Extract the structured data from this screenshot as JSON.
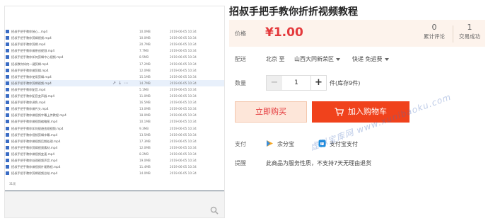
{
  "gallery": {
    "files": [
      {
        "name": "招叔手把手教你装心...mp4",
        "size": "10.0MB",
        "date": "2019-06-05 10:34"
      },
      {
        "name": "招叔手把手教你剪辑视频.mp4",
        "size": "10.0MB",
        "date": "2019-06-05 10:34"
      },
      {
        "name": "招叔手把手教你剪辑.mp4",
        "size": "20.7MB",
        "date": "2019-06-05 10:34"
      },
      {
        "name": "招叔手把手教你做原创视频.mp4",
        "size": "7.7MB",
        "date": "2019-06-05 10:34"
      },
      {
        "name": "招叔手把手教你如何剪辑中心视频.mp4",
        "size": "8.5MB",
        "date": "2019-06-05 10:34"
      },
      {
        "name": "招叔教你如何一键剪辑.mp4",
        "size": "17.2MB",
        "date": "2019-06-05 10:34"
      },
      {
        "name": "招叔手把手教你做剪辑.mp4",
        "size": "12.0MB",
        "date": "2019-06-05 10:34"
      },
      {
        "name": "招叔手把手教你使用剪辑.mp4",
        "size": "15.1MB",
        "date": "2019-06-05 10:34"
      },
      {
        "name": "招叔手把手教你剪辑视频.mp4",
        "size": "14.7MB",
        "date": "2019-06-05 10:34",
        "highlight": true
      },
      {
        "name": "招叔手把手教你配音.mp4",
        "size": "5.1MB",
        "date": "2019-06-05 10:34"
      },
      {
        "name": "招叔手把手教你配音变声器.mp4",
        "size": "11.0MB",
        "date": "2019-06-05 10:34"
      },
      {
        "name": "招叔手把手教你调色.mp4",
        "size": "16.5MB",
        "date": "2019-06-05 10:34"
      },
      {
        "name": "招叔手把手教你做片头.mp4",
        "size": "13.0MB",
        "date": "2019-06-05 10:34"
      },
      {
        "name": "招叔手把手教你做视频字幕上传教程.mp4",
        "size": "18.0MB",
        "date": "2019-06-05 10:34"
      },
      {
        "name": "招叔手把手教你做视频缩略图.mp4",
        "size": "10.1MB",
        "date": "2019-06-05 10:34"
      },
      {
        "name": "招叔手把手教你如何规避违规视频.mp4",
        "size": "9.3MB",
        "date": "2019-06-05 10:34"
      },
      {
        "name": "招叔手把手教你视频剪辑字幕.mp4",
        "size": "13.5MB",
        "date": "2019-06-05 10:34"
      },
      {
        "name": "招叔手把手教你做视频后期处理.mp4",
        "size": "17.3MB",
        "date": "2019-06-05 10:34"
      },
      {
        "name": "招叔手把手教你剪辑视频素材.mp4",
        "size": "12.0MB",
        "date": "2019-06-05 10:34"
      },
      {
        "name": "招叔手把手教你做视频变速.mp4",
        "size": "8.2MB",
        "date": "2019-06-05 10:34"
      },
      {
        "name": "招叔手把手教你处理视频声音.mp4",
        "size": "19.0MB",
        "date": "2019-06-05 10:34"
      },
      {
        "name": "招叔手把手教你做视频片尾教程.mp4",
        "size": "11.4MB",
        "date": "2019-06-05 10:34"
      },
      {
        "name": "招叔手把手教你剪辑视频总结.mp4",
        "size": "14.0MB",
        "date": "2019-06-05 10:34"
      }
    ],
    "count_text": "31项"
  },
  "product": {
    "title": "招叔手把手教你折折视频教程",
    "price_label": "价格",
    "price": "¥1.00",
    "reviews_count": "0",
    "reviews_label": "累计评论",
    "sales_count": "1",
    "sales_label": "交易成功",
    "delivery_label": "配送",
    "delivery_from": "北京 至",
    "delivery_to": "山西大同新荣区",
    "shipping": "快递 免运费",
    "qty_label": "数量",
    "qty_minus": "−",
    "qty_value": "1",
    "qty_plus": "+",
    "stock": "件(库存9件)",
    "buy_now": "立即购买",
    "add_cart": "加入购物车",
    "pay_label": "支付",
    "pay1": "余分宝",
    "pay2": "支付宝支付",
    "notice_label": "提醒",
    "notice": "此商品为服务性质，不支持7天无理由退货",
    "watermark": "虚拟宝库网 www.xunibaoku.com"
  },
  "colors": {
    "accent": "#e4393c",
    "cart": "#f0421c",
    "price_bg": "#fdf3ec"
  }
}
